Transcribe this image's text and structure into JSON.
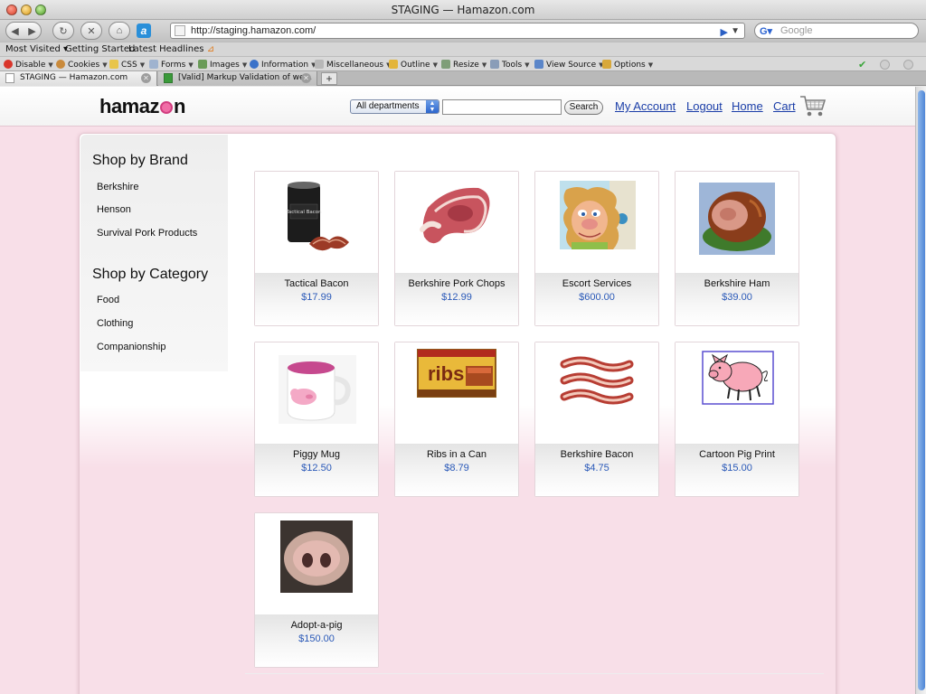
{
  "browser": {
    "window_title": "STAGING — Hamazon.com",
    "url": "http://staging.hamazon.com/",
    "search_placeholder": "Google",
    "bookmarks": [
      "Most Visited",
      "Getting Started",
      "Latest Headlines"
    ],
    "devtools": [
      "Disable",
      "Cookies",
      "CSS",
      "Forms",
      "Images",
      "Information",
      "Miscellaneous",
      "Outline",
      "Resize",
      "Tools",
      "View Source",
      "Options"
    ],
    "tabs": [
      "STAGING — Hamazon.com",
      "[Valid] Markup Validation of we..."
    ],
    "new_tab": "+"
  },
  "site": {
    "logo_left": "hamaz",
    "logo_right": "n",
    "department_select": "All departments",
    "search_button": "Search",
    "nav": [
      "My Account",
      "Logout",
      "Home",
      "Cart"
    ]
  },
  "sidebar": {
    "brand_heading": "Shop by Brand",
    "brands": [
      "Berkshire",
      "Henson",
      "Survival Pork Products"
    ],
    "category_heading": "Shop by Category",
    "categories": [
      "Food",
      "Clothing",
      "Companionship"
    ]
  },
  "products": [
    {
      "name": "Tactical Bacon",
      "price": "$17.99",
      "label_text": "Tactical Bacon"
    },
    {
      "name": "Berkshire Pork Chops",
      "price": "$12.99"
    },
    {
      "name": "Escort Services",
      "price": "$600.00"
    },
    {
      "name": "Berkshire Ham",
      "price": "$39.00"
    },
    {
      "name": "Piggy Mug",
      "price": "$12.50"
    },
    {
      "name": "Ribs in a Can",
      "price": "$8.79",
      "label_text": "ribs"
    },
    {
      "name": "Berkshire Bacon",
      "price": "$4.75"
    },
    {
      "name": "Cartoon Pig Print",
      "price": "$15.00"
    },
    {
      "name": "Adopt-a-pig",
      "price": "$150.00"
    }
  ],
  "colors": {
    "page_background": "#f8dfe8",
    "link": "#1b3ea8",
    "price": "#2a59b8",
    "logo_accent": "#f06da6"
  }
}
